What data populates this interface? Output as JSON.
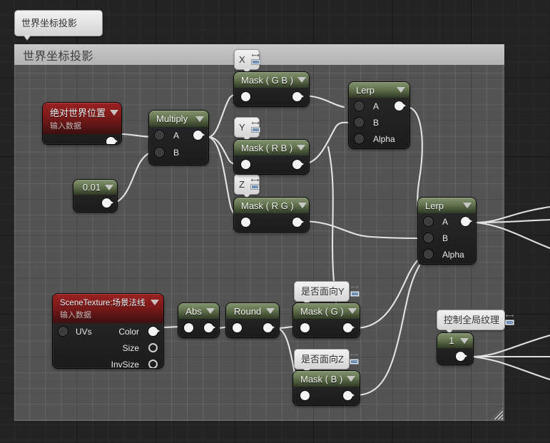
{
  "graph": {
    "top_label": {
      "text": "世界坐标投影",
      "icon": "keyboard-pin-icon"
    },
    "comment": {
      "title": "世界坐标投影"
    }
  },
  "bubbles": [
    {
      "name": "bubble-x",
      "text": "X",
      "icon": "keyboard-pin-icon"
    },
    {
      "name": "bubble-y",
      "text": "Y",
      "icon": "keyboard-pin-icon"
    },
    {
      "name": "bubble-z",
      "text": "Z",
      "icon": "keyboard-pin-icon"
    },
    {
      "name": "bubble-faceY",
      "text": "是否面向Y",
      "icon": "keyboard-pin-icon"
    },
    {
      "name": "bubble-faceZ",
      "text": "是否面向Z",
      "icon": "keyboard-pin-icon"
    },
    {
      "name": "bubble-global",
      "text": "控制全局纹理",
      "icon": "keyboard-pin-icon"
    }
  ],
  "nodes": {
    "world_position": {
      "title": "绝对世界位置",
      "subtitle": "输入数据"
    },
    "multiply": {
      "title": "Multiply",
      "in_a": "A",
      "in_b": "B"
    },
    "constant": {
      "title": "0.01"
    },
    "mask_gb": {
      "title": "Mask ( G B )"
    },
    "mask_rb": {
      "title": "Mask ( R B )"
    },
    "mask_rg": {
      "title": "Mask ( R G )"
    },
    "lerp_top": {
      "title": "Lerp",
      "in_a": "A",
      "in_b": "B",
      "in_alpha": "Alpha"
    },
    "lerp_mid": {
      "title": "Lerp",
      "in_a": "A",
      "in_b": "B",
      "in_alpha": "Alpha"
    },
    "scene_texture": {
      "title": "SceneTexture:场景法线",
      "subtitle": "输入数据",
      "in_uvs": "UVs",
      "out_color": "Color",
      "out_size": "Size",
      "out_invsize": "InvSize"
    },
    "abs": {
      "title": "Abs"
    },
    "round": {
      "title": "Round"
    },
    "mask_g": {
      "title": "Mask ( G )"
    },
    "mask_b": {
      "title": "Mask ( B )"
    },
    "one": {
      "title": "1"
    }
  },
  "colors": {
    "node_header_green": "#63734f",
    "node_header_red": "#7c1a1a",
    "node_body": "#232323",
    "comment_bg": "#969696",
    "wire": "#f0f0f0",
    "canvas": "#232323"
  }
}
